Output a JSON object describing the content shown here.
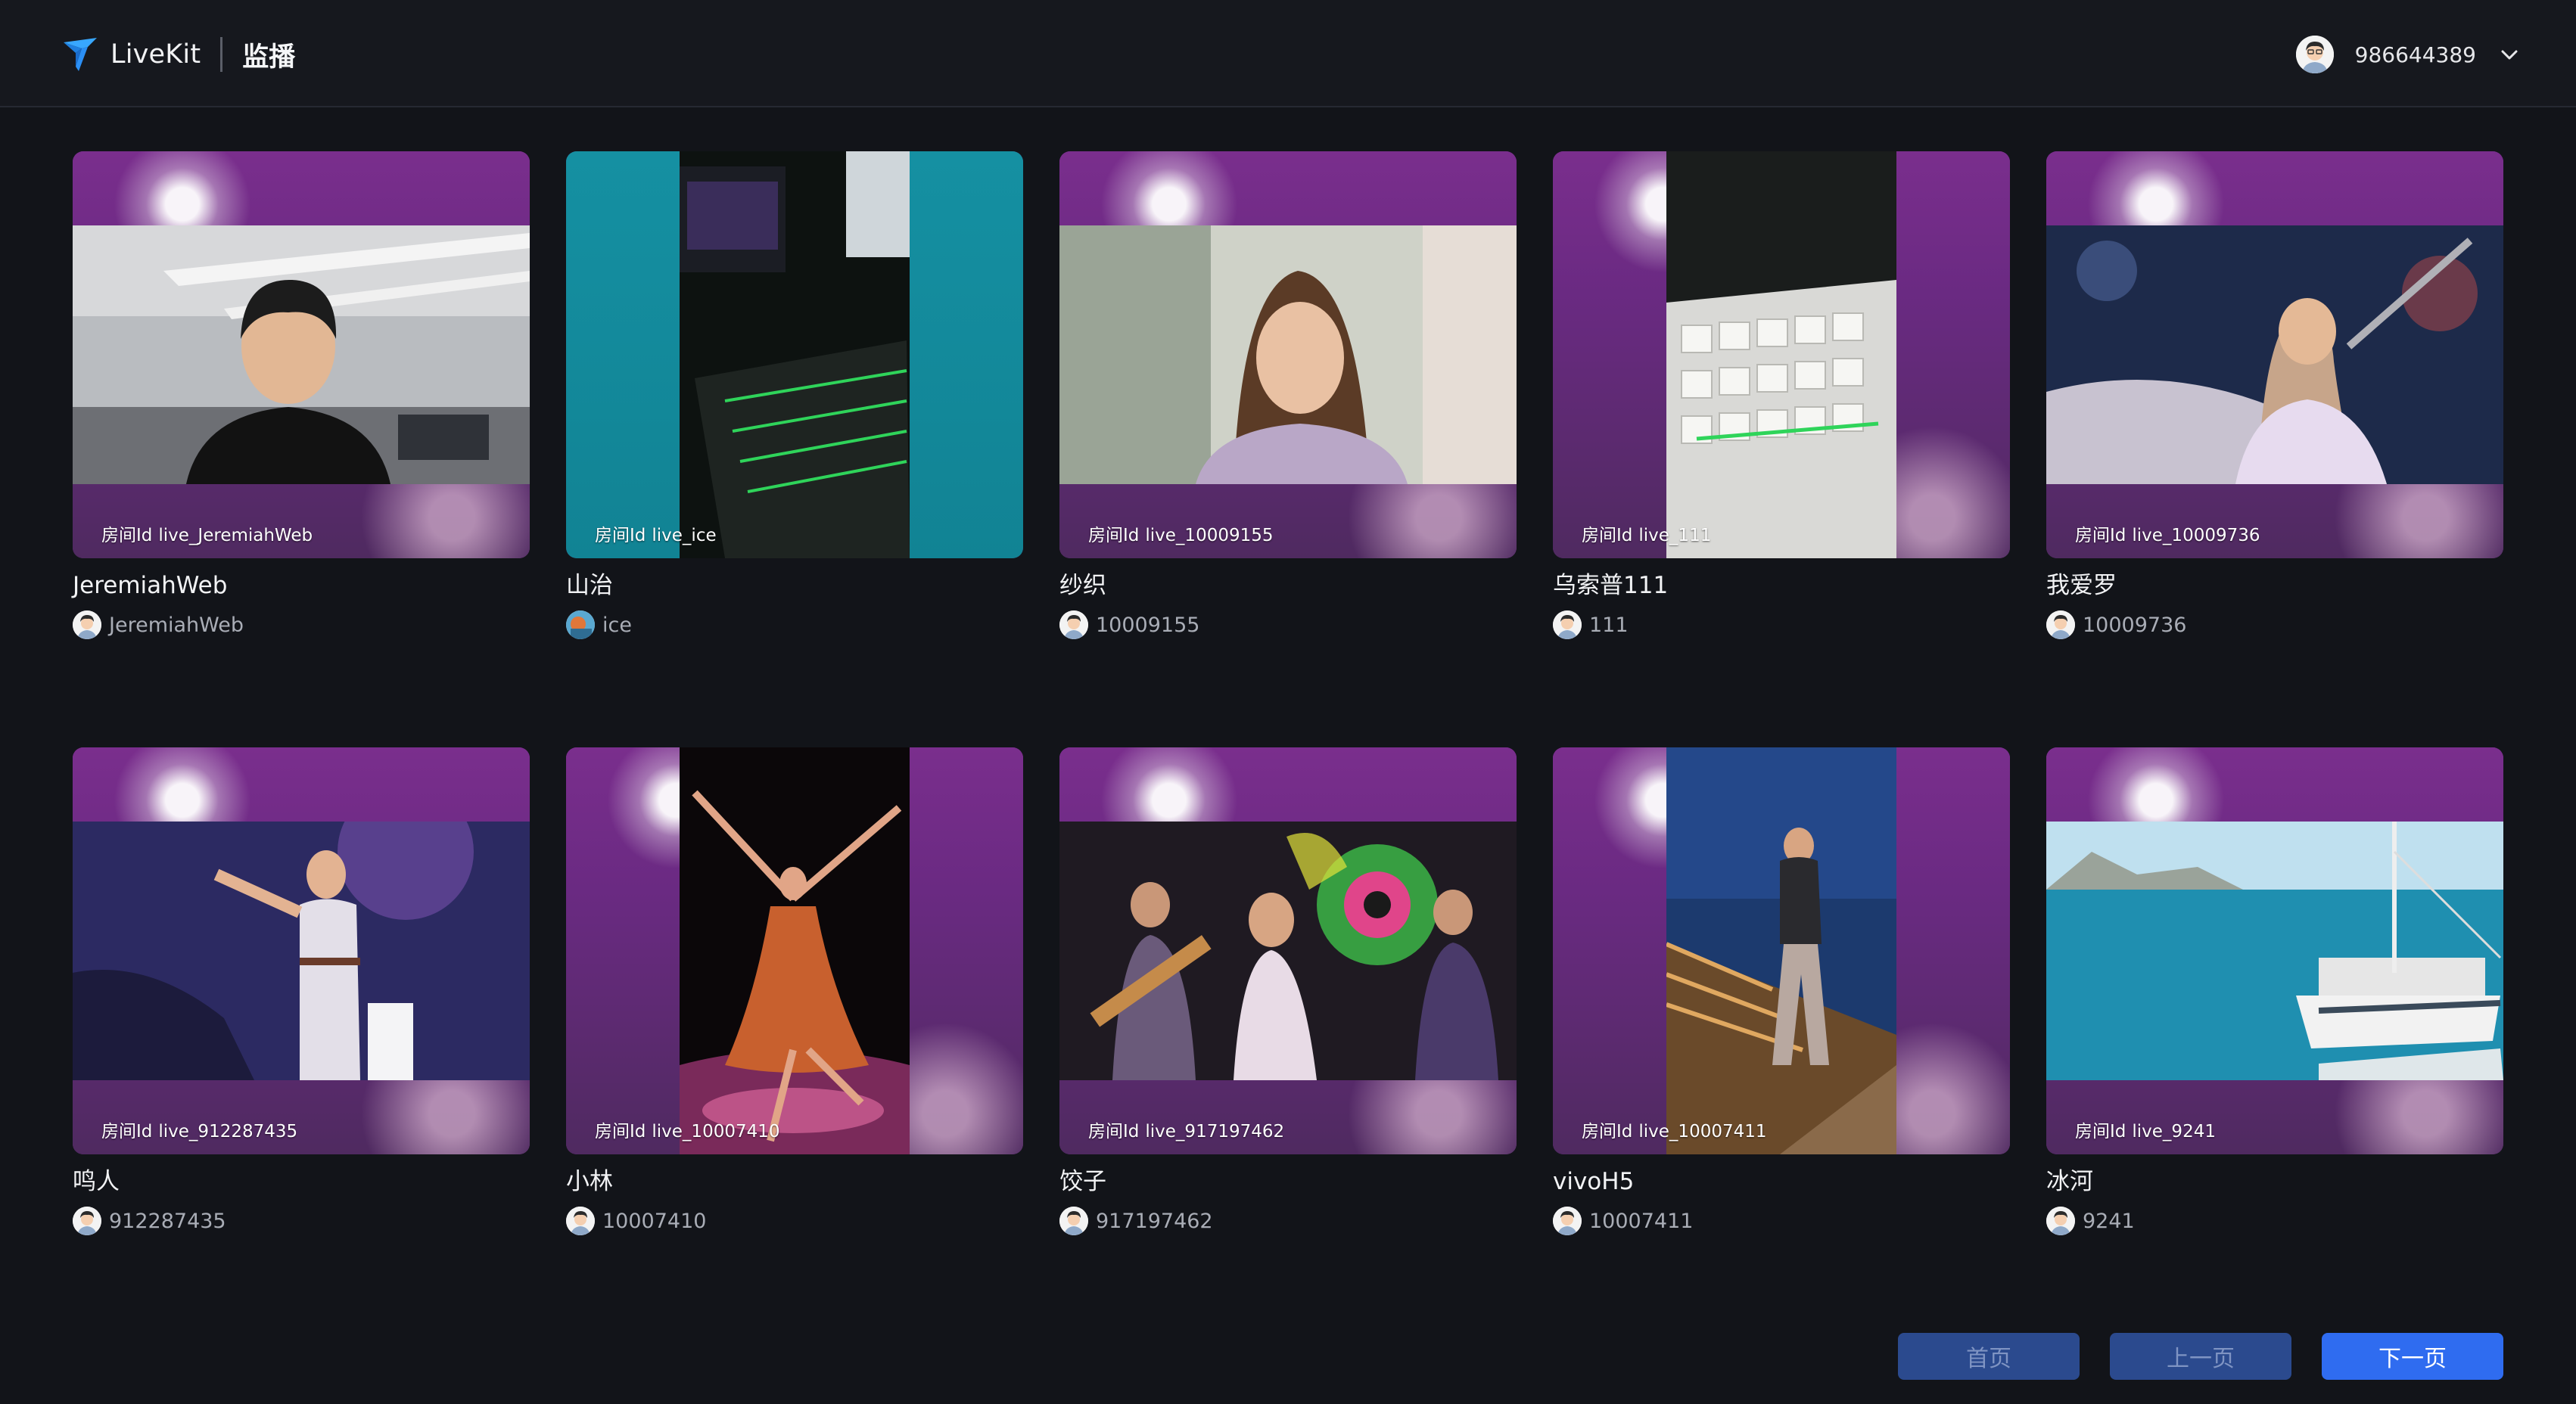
{
  "header": {
    "brand": "LiveKit",
    "page_title": "监播",
    "user_name": "986644389",
    "icons": {
      "logo": "livekit-logo-icon",
      "dropdown": "chevron-down-icon"
    }
  },
  "room_prefix": "房间Id",
  "rooms": [
    {
      "room_id": "live_JeremiahWeb",
      "title": "JeremiahWeb",
      "host": "JeremiahWeb"
    },
    {
      "room_id": "live_ice",
      "title": "山治",
      "host": "ice"
    },
    {
      "room_id": "live_10009155",
      "title": "纱织",
      "host": "10009155"
    },
    {
      "room_id": "live_111",
      "title": "乌索普111",
      "host": "111"
    },
    {
      "room_id": "live_10009736",
      "title": "我爱罗",
      "host": "10009736"
    },
    {
      "room_id": "live_912287435",
      "title": "鸣人",
      "host": "912287435"
    },
    {
      "room_id": "live_10007410",
      "title": "小林",
      "host": "10007410"
    },
    {
      "room_id": "live_917197462",
      "title": "饺子",
      "host": "917197462"
    },
    {
      "room_id": "live_10007411",
      "title": "vivoH5",
      "host": "10007411"
    },
    {
      "room_id": "live_9241",
      "title": "冰河",
      "host": "9241"
    }
  ],
  "pagination": {
    "first": "首页",
    "prev": "上一页",
    "next": "下一页"
  },
  "colors": {
    "accent": "#2f6cf0",
    "background": "#121419",
    "card_purple": "#6b2a82"
  }
}
